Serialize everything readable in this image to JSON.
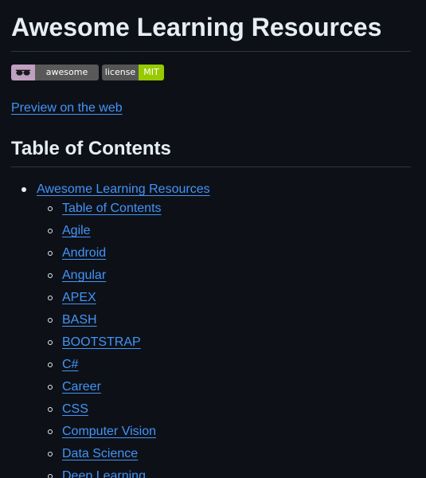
{
  "page": {
    "title": "Awesome Learning Resources",
    "badges": [
      {
        "name": "awesome-badge",
        "left_icon": "sunglasses-icon",
        "right_text": "awesome"
      },
      {
        "name": "license-badge",
        "left_text": "license",
        "right_text": "MIT"
      }
    ],
    "preview_link": "Preview on the web",
    "toc_heading": "Table of Contents",
    "toc": {
      "top_item": "Awesome Learning Resources",
      "sub_items": [
        "Table of Contents",
        "Agile",
        "Android",
        "Angular",
        "APEX",
        "BASH",
        "BOOTSTRAP",
        "C#",
        "Career",
        "CSS",
        "Computer Vision",
        "Data Science",
        "Deep Learning"
      ]
    },
    "colors": {
      "background": "#0d1117",
      "text": "#e6edf3",
      "link": "#4493f8",
      "rule": "#30363d"
    }
  }
}
